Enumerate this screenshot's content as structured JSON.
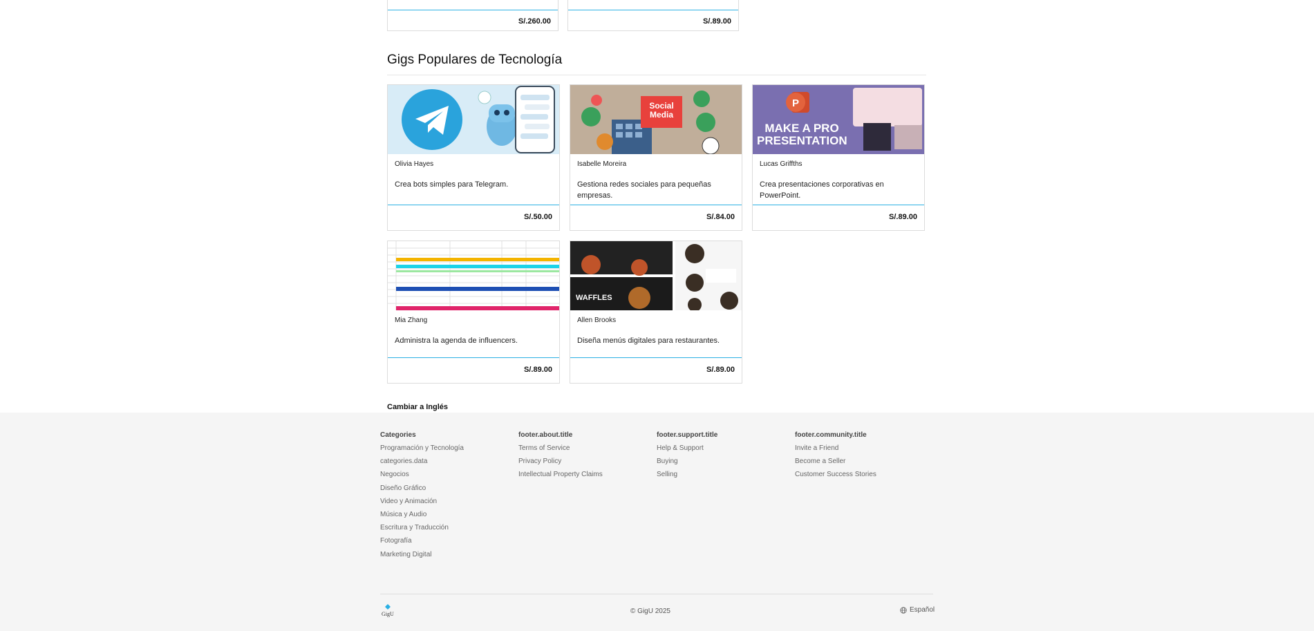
{
  "previous_row": {
    "prices": [
      "S/.260.00",
      "S/.89.00"
    ]
  },
  "section": {
    "title": "Gigs Populares de Tecnología"
  },
  "gigs": [
    {
      "seller": "Olivia Hayes",
      "description": "Crea bots simples para Telegram.",
      "price": "S/.50.00",
      "image": "telegram-bot-thumbnail"
    },
    {
      "seller": "Isabelle Moreira",
      "description": "Gestiona redes sociales para pequeñas empresas.",
      "price": "S/.84.00",
      "image": "social-media-thumbnail",
      "image_text": "Social Media"
    },
    {
      "seller": "Lucas Griffths",
      "description": "Crea presentaciones corporativas en PowerPoint.",
      "price": "S/.89.00",
      "image": "powerpoint-thumbnail",
      "image_text": "MAKE A PRO PRESENTATION"
    },
    {
      "seller": "Mia Zhang",
      "description": "Administra la agenda de influencers.",
      "price": "S/.89.00",
      "image": "spreadsheet-thumbnail"
    },
    {
      "seller": "Allen Brooks",
      "description": "Diseña menús digitales para restaurantes.",
      "price": "S/.89.00",
      "image": "restaurant-menu-thumbnail",
      "image_text": "WAFFLES"
    }
  ],
  "language_toggle": "Cambiar a Inglés",
  "footer": {
    "columns": [
      {
        "title": "Categories",
        "links": [
          "Programación y Tecnología",
          "categories.data",
          "Negocios",
          "Diseño Gráfico",
          "Video y Animación",
          "Música y Audio",
          "Escritura y Traducción",
          "Fotografía",
          "Marketing Digital"
        ]
      },
      {
        "title": "footer.about.title",
        "links": [
          "Terms of Service",
          "Privacy Policy",
          "Intellectual Property Claims"
        ]
      },
      {
        "title": "footer.support.title",
        "links": [
          "Help & Support",
          "Buying",
          "Selling"
        ]
      },
      {
        "title": "footer.community.title",
        "links": [
          "Invite a Friend",
          "Become a Seller",
          "Customer Success Stories"
        ]
      }
    ],
    "logo_text": "GigU",
    "copyright": "© GigU 2025",
    "language": "Español"
  },
  "colors": {
    "accent": "#2ab0e4",
    "footer_bg": "#f5f5f5"
  }
}
